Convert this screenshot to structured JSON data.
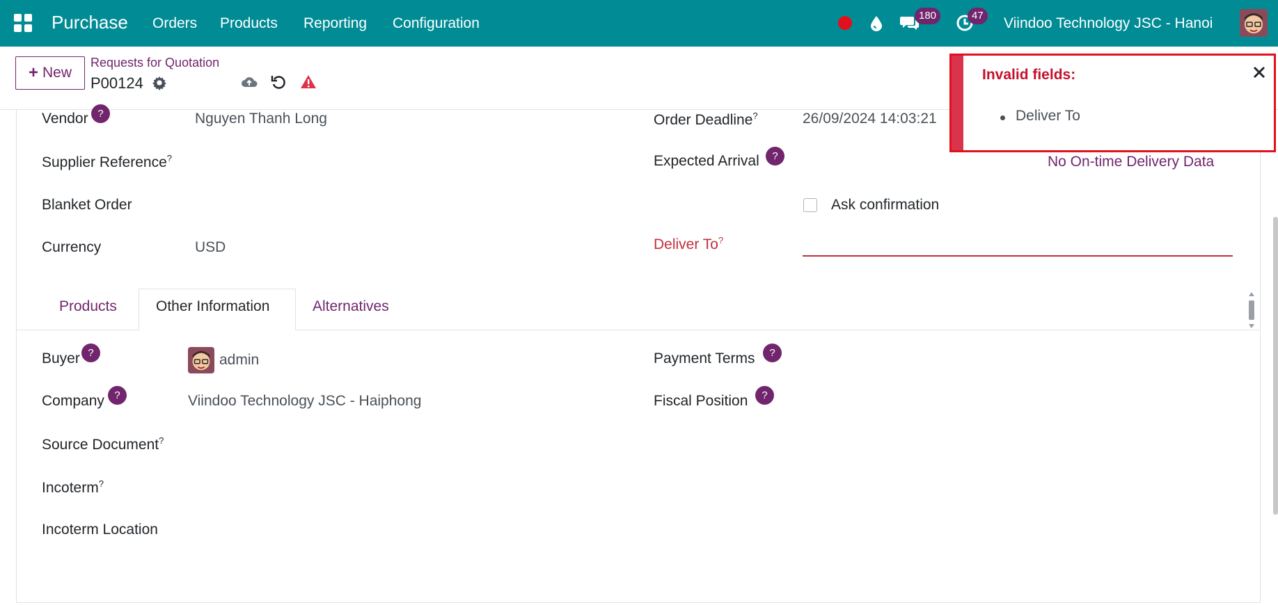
{
  "navbar": {
    "app_name": "Purchase",
    "menus": [
      "Orders",
      "Products",
      "Reporting",
      "Configuration"
    ],
    "messages_count": "180",
    "activities_count": "47",
    "company": "Viindoo Technology JSC - Hanoi",
    "bg_color": "#018c95"
  },
  "control": {
    "new_label": "New",
    "breadcrumb_parent": "Requests for Quotation",
    "record_name": "P00124"
  },
  "form": {
    "vendor_label": "Vendor",
    "vendor_value": "Nguyen Thanh Long",
    "supplier_ref_label": "Supplier Reference",
    "blanket_order_label": "Blanket Order",
    "currency_label": "Currency",
    "currency_value": "USD",
    "order_deadline_label": "Order Deadline",
    "order_deadline_value": "26/09/2024 14:03:21",
    "expected_arrival_label": "Expected Arrival",
    "on_time_link": "No On-time Delivery Data",
    "ask_confirmation_label": "Ask confirmation",
    "deliver_to_label": "Deliver To"
  },
  "tabs": [
    "Products",
    "Other Information",
    "Alternatives"
  ],
  "other_info": {
    "buyer_label": "Buyer",
    "buyer_value": "admin",
    "company_label": "Company",
    "company_value": "Viindoo Technology JSC - Haiphong",
    "source_document_label": "Source Document",
    "incoterm_label": "Incoterm",
    "incoterm_location_label": "Incoterm Location",
    "payment_terms_label": "Payment Terms",
    "fiscal_position_label": "Fiscal Position"
  },
  "help_marker": "?",
  "help_superscript": "?",
  "notification": {
    "title": "Invalid fields:",
    "items": [
      "Deliver To"
    ]
  },
  "colors": {
    "primary": "#71256d",
    "invalid": "#c32e3e",
    "toast_border": "#e2101c"
  }
}
